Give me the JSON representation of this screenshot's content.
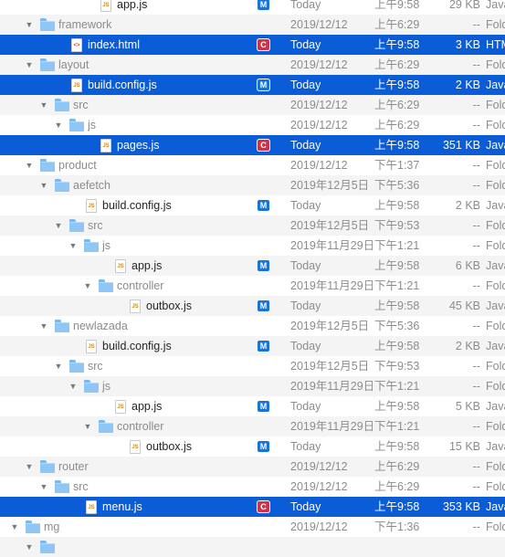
{
  "rows": [
    {
      "indent": 5,
      "kind": "file",
      "glyph": "JS",
      "name": "app.js",
      "badge": "M",
      "date": "Today",
      "time": "上午9:58",
      "size": "29 KB",
      "type": "Java"
    },
    {
      "indent": 1,
      "kind": "folder",
      "expanded": true,
      "name": "framework",
      "date": "2019/12/12",
      "time": "上午6:29",
      "size": "--",
      "type": "Fold"
    },
    {
      "indent": 3,
      "kind": "file",
      "glyph": "<>",
      "html": true,
      "name": "index.html",
      "badge": "C",
      "date": "Today",
      "time": "上午9:58",
      "size": "3 KB",
      "type": "HTM",
      "selected": true
    },
    {
      "indent": 1,
      "kind": "folder",
      "expanded": true,
      "name": "layout",
      "date": "2019/12/12",
      "time": "上午6:29",
      "size": "--",
      "type": "Fold"
    },
    {
      "indent": 3,
      "kind": "file",
      "glyph": "JS",
      "name": "build.config.js",
      "badge": "M",
      "date": "Today",
      "time": "上午9:58",
      "size": "2 KB",
      "type": "Java",
      "selected": true
    },
    {
      "indent": 2,
      "kind": "folder",
      "expanded": true,
      "name": "src",
      "date": "2019/12/12",
      "time": "上午6:29",
      "size": "--",
      "type": "Fold"
    },
    {
      "indent": 3,
      "kind": "folder",
      "expanded": true,
      "name": "js",
      "date": "2019/12/12",
      "time": "上午6:29",
      "size": "--",
      "type": "Fold"
    },
    {
      "indent": 5,
      "kind": "file",
      "glyph": "JS",
      "name": "pages.js",
      "badge": "C",
      "date": "Today",
      "time": "上午9:58",
      "size": "351 KB",
      "type": "Java",
      "selected": true
    },
    {
      "indent": 1,
      "kind": "folder",
      "expanded": true,
      "name": "product",
      "date": "2019/12/12",
      "time": "下午1:37",
      "size": "--",
      "type": "Fold"
    },
    {
      "indent": 2,
      "kind": "folder",
      "expanded": true,
      "name": "aefetch",
      "date": "2019年12月5日",
      "time": "下午5:36",
      "size": "--",
      "type": "Fold"
    },
    {
      "indent": 4,
      "kind": "file",
      "glyph": "JS",
      "name": "build.config.js",
      "badge": "M",
      "date": "Today",
      "time": "上午9:58",
      "size": "2 KB",
      "type": "Java"
    },
    {
      "indent": 3,
      "kind": "folder",
      "expanded": true,
      "name": "src",
      "date": "2019年12月5日",
      "time": "下午9:53",
      "size": "--",
      "type": "Fold"
    },
    {
      "indent": 4,
      "kind": "folder",
      "expanded": true,
      "name": "js",
      "date": "2019年11月29日",
      "time": "下午1:21",
      "size": "--",
      "type": "Fold"
    },
    {
      "indent": 6,
      "kind": "file",
      "glyph": "JS",
      "name": "app.js",
      "badge": "M",
      "date": "Today",
      "time": "上午9:58",
      "size": "6 KB",
      "type": "Java"
    },
    {
      "indent": 5,
      "kind": "folder",
      "expanded": true,
      "name": "controller",
      "date": "2019年11月29日",
      "time": "下午1:21",
      "size": "--",
      "type": "Fold"
    },
    {
      "indent": 7,
      "kind": "file",
      "glyph": "JS",
      "name": "outbox.js",
      "badge": "M",
      "date": "Today",
      "time": "上午9:58",
      "size": "45 KB",
      "type": "Java"
    },
    {
      "indent": 2,
      "kind": "folder",
      "expanded": true,
      "name": "newlazada",
      "date": "2019年12月5日",
      "time": "下午5:36",
      "size": "--",
      "type": "Fold"
    },
    {
      "indent": 4,
      "kind": "file",
      "glyph": "JS",
      "name": "build.config.js",
      "badge": "M",
      "date": "Today",
      "time": "上午9:58",
      "size": "2 KB",
      "type": "Java"
    },
    {
      "indent": 3,
      "kind": "folder",
      "expanded": true,
      "name": "src",
      "date": "2019年12月5日",
      "time": "下午9:53",
      "size": "--",
      "type": "Fold"
    },
    {
      "indent": 4,
      "kind": "folder",
      "expanded": true,
      "name": "js",
      "date": "2019年11月29日",
      "time": "下午1:21",
      "size": "--",
      "type": "Fold"
    },
    {
      "indent": 6,
      "kind": "file",
      "glyph": "JS",
      "name": "app.js",
      "badge": "M",
      "date": "Today",
      "time": "上午9:58",
      "size": "5 KB",
      "type": "Java"
    },
    {
      "indent": 5,
      "kind": "folder",
      "expanded": true,
      "name": "controller",
      "date": "2019年11月29日",
      "time": "下午1:21",
      "size": "--",
      "type": "Fold"
    },
    {
      "indent": 7,
      "kind": "file",
      "glyph": "JS",
      "name": "outbox.js",
      "badge": "M",
      "date": "Today",
      "time": "上午9:58",
      "size": "15 KB",
      "type": "Java"
    },
    {
      "indent": 1,
      "kind": "folder",
      "expanded": true,
      "name": "router",
      "date": "2019/12/12",
      "time": "上午6:29",
      "size": "--",
      "type": "Fold"
    },
    {
      "indent": 2,
      "kind": "folder",
      "expanded": true,
      "name": "src",
      "date": "2019/12/12",
      "time": "上午6:29",
      "size": "--",
      "type": "Fold"
    },
    {
      "indent": 4,
      "kind": "file",
      "glyph": "JS",
      "name": "menu.js",
      "badge": "C",
      "date": "Today",
      "time": "上午9:58",
      "size": "353 KB",
      "type": "Java",
      "selected": true
    },
    {
      "indent": 0,
      "kind": "folder",
      "expanded": true,
      "name": "mg",
      "date": "2019/12/12",
      "time": "下午1:36",
      "size": "--",
      "type": "Fold"
    },
    {
      "indent": 1,
      "kind": "folder",
      "expanded": true,
      "name": "",
      "date": "",
      "time": "",
      "size": "",
      "type": ""
    }
  ],
  "colors": {
    "selection": "#0a5dd6",
    "badge_modified": "#1a73d9",
    "badge_conflict": "#d0324a",
    "folder": "#8fc6f5"
  },
  "icons": {
    "disclosure": "disclosure-triangle-icon",
    "folder": "folder-icon",
    "file": "file-icon"
  }
}
